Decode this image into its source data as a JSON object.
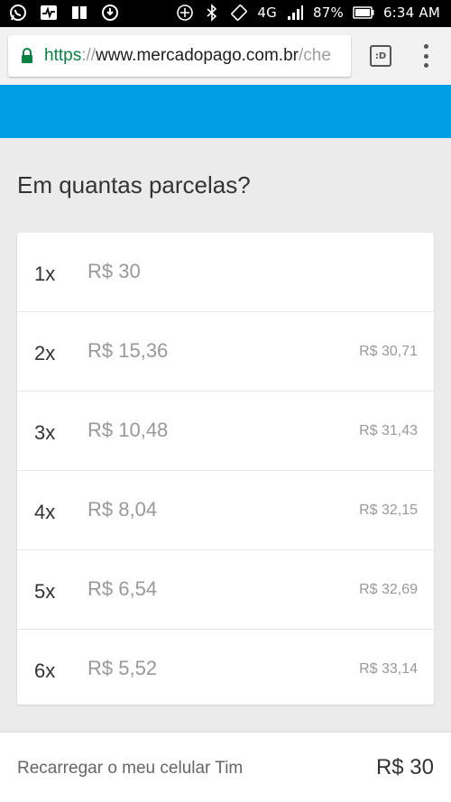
{
  "status_bar": {
    "battery": "87%",
    "time": "6:34 AM",
    "network": "4G",
    "icons": [
      "whatsapp-icon",
      "activity-icon",
      "book-icon",
      "sync-icon",
      "add-circle-icon",
      "bluetooth-icon",
      "vibrate-icon",
      "signal-icon",
      "battery-icon"
    ]
  },
  "browser": {
    "url_scheme": "https",
    "url_separator": "://",
    "url_host": "www.mercadopago.com.br",
    "url_path": "/che",
    "tabs_label": ":D"
  },
  "colors": {
    "brand_blue": "#009ee3",
    "secure_green": "#0b8043"
  },
  "page": {
    "question": "Em quantas parcelas?"
  },
  "installments": [
    {
      "count": "1x",
      "amount": "R$ 30",
      "total": ""
    },
    {
      "count": "2x",
      "amount": "R$ 15,36",
      "total": "R$ 30,71"
    },
    {
      "count": "3x",
      "amount": "R$ 10,48",
      "total": "R$ 31,43"
    },
    {
      "count": "4x",
      "amount": "R$ 8,04",
      "total": "R$ 32,15"
    },
    {
      "count": "5x",
      "amount": "R$ 6,54",
      "total": "R$ 32,69"
    },
    {
      "count": "6x",
      "amount": "R$ 5,52",
      "total": "R$ 33,14"
    }
  ],
  "footer": {
    "label": "Recarregar o meu celular Tim",
    "amount": "R$ 30"
  }
}
